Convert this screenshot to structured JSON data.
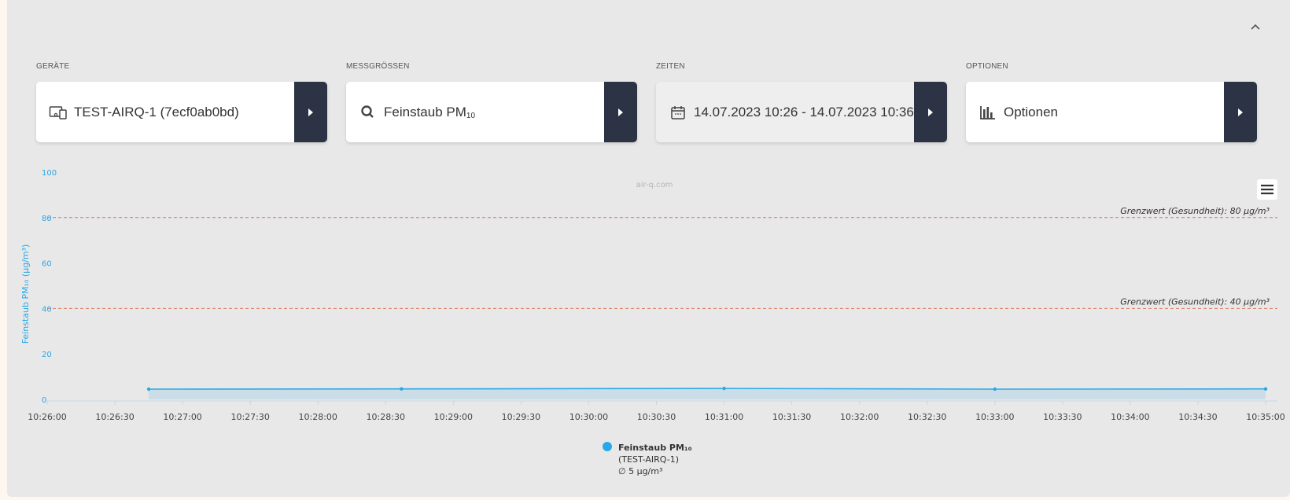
{
  "groups": [
    {
      "label": "GERÄTE",
      "value": "TEST-AIRQ-1 (7ecf0ab0bd)",
      "icon": "device-icon"
    },
    {
      "label": "MESSGRÖSSEN",
      "value": "Feinstaub PM",
      "value_sub": "10",
      "icon": "search-icon"
    },
    {
      "label": "ZEITEN",
      "value": "14.07.2023 10:26 - 14.07.2023 10:36",
      "icon": "calendar-icon"
    },
    {
      "label": "OPTIONEN",
      "value": "Optionen",
      "icon": "bar-chart-icon"
    }
  ],
  "colors": {
    "accent": "#29a8e8",
    "dark_button": "#2c3344",
    "threshold": "#d9785a"
  },
  "chart_data": {
    "type": "line",
    "watermark": "air-q.com",
    "ylabel": "Feinstaub PM₁₀ (µg/m³)",
    "ylim": [
      0,
      100
    ],
    "y_ticks": [
      0,
      20,
      40,
      60,
      80,
      100
    ],
    "x_ticks": [
      "10:26:00",
      "10:26:30",
      "10:27:00",
      "10:27:30",
      "10:28:00",
      "10:28:30",
      "10:29:00",
      "10:29:30",
      "10:30:00",
      "10:30:30",
      "10:31:00",
      "10:31:30",
      "10:32:00",
      "10:32:30",
      "10:33:00",
      "10:33:30",
      "10:34:00",
      "10:34:30",
      "10:35:00"
    ],
    "x_range_seconds": [
      0,
      540
    ],
    "series": [
      {
        "name": "Feinstaub PM₁₀ (TEST-AIRQ-1)",
        "legend_lines": [
          "Feinstaub PM₁₀",
          "(TEST-AIRQ-1)",
          "∅ 5 µg/m³"
        ],
        "x": [
          "10:26:45",
          "10:28:37",
          "10:31:00",
          "10:33:00",
          "10:35:00"
        ],
        "x_seconds": [
          45,
          157,
          300,
          420,
          540
        ],
        "values": [
          4.5,
          4.6,
          4.8,
          4.5,
          4.6
        ]
      }
    ],
    "thresholds": [
      {
        "value": 80,
        "label": "Grenzwert (Gesundheit): 80 µg/m³"
      },
      {
        "value": 40,
        "label": "Grenzwert (Gesundheit): 40 µg/m³"
      }
    ],
    "grid": false,
    "legend": "bottom-center"
  }
}
